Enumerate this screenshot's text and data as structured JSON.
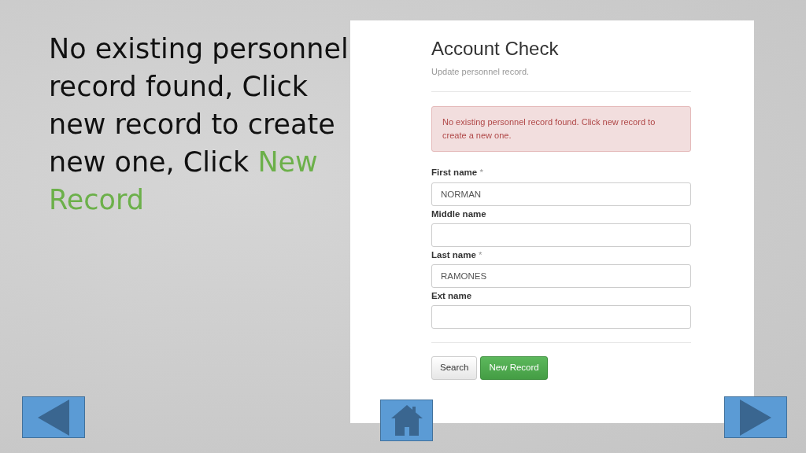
{
  "instruction": {
    "text": "No existing personnel record found, Click new record to create new one, Click ",
    "highlight": "New Record"
  },
  "form": {
    "title": "Account Check",
    "subtitle": "Update personnel record.",
    "alert": "No existing personnel record found. Click new record to create a new one.",
    "fields": [
      {
        "label": "First name",
        "required_mark": "*",
        "value": "NORMAN"
      },
      {
        "label": "Middle name"
      },
      {
        "label": "Last name",
        "required_mark": "*",
        "value": "RAMONES"
      },
      {
        "label": "Ext name"
      }
    ],
    "buttons": [
      {
        "label": "Search",
        "kind": "default"
      },
      {
        "label": "New Record",
        "kind": "success"
      }
    ]
  },
  "navigation": [
    {
      "kind": "back"
    },
    {
      "kind": "home"
    },
    {
      "kind": "next"
    }
  ]
}
